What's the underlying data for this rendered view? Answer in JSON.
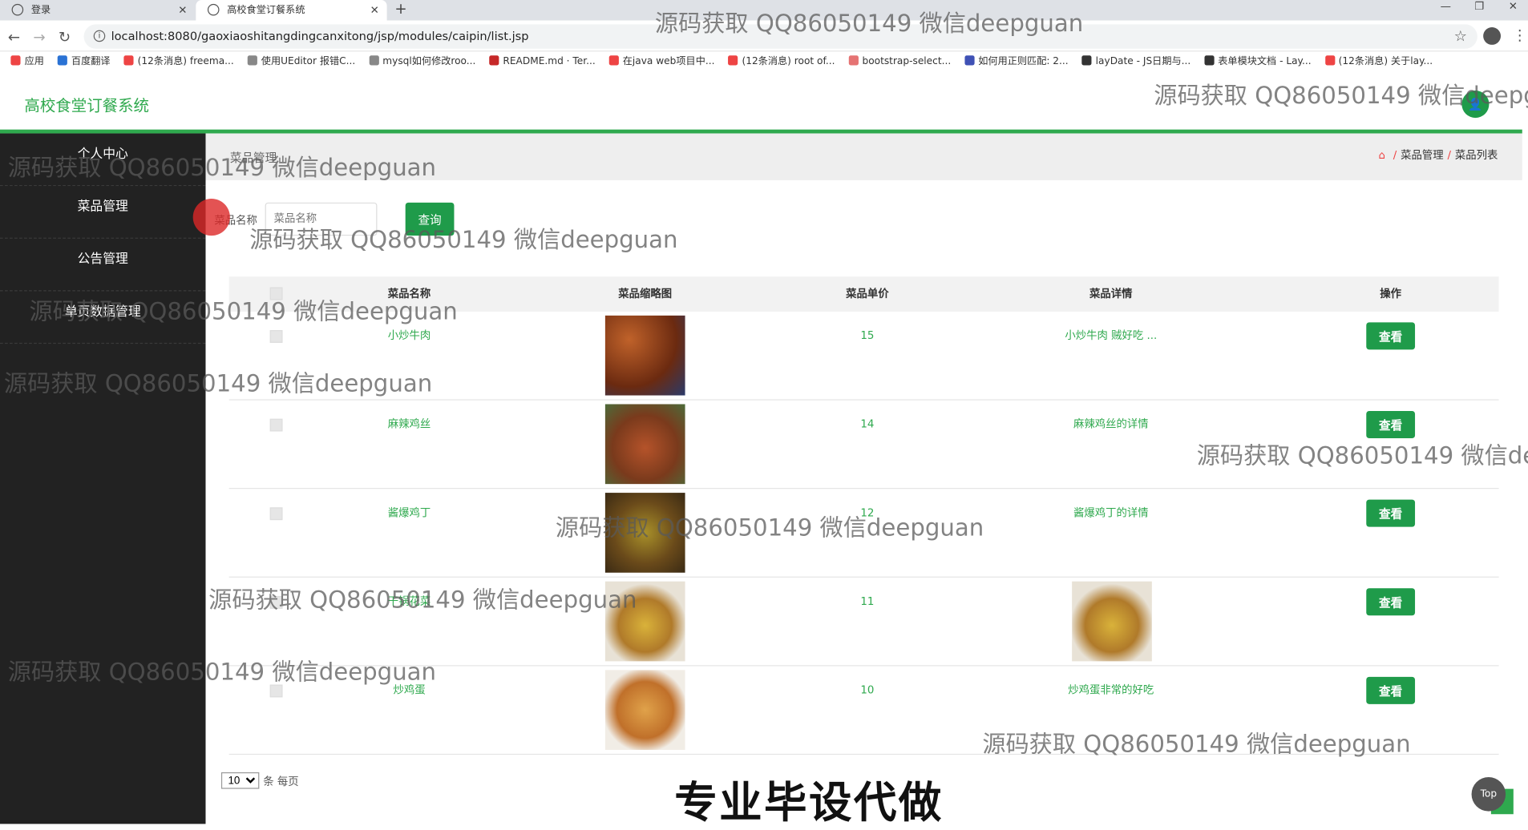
{
  "browser": {
    "tabs": [
      {
        "title": "登录",
        "active": false
      },
      {
        "title": "高校食堂订餐系统",
        "active": true
      }
    ],
    "new_tab": "+",
    "url": "localhost:8080/gaoxiaoshitangdingcanxitong/jsp/modules/caipin/list.jsp",
    "bookmarks": [
      {
        "label": "应用",
        "icon_color": "#e44"
      },
      {
        "label": "百度翻译",
        "icon_color": "#2a72d4"
      },
      {
        "label": "(12条消息) freema...",
        "icon_color": "#e44"
      },
      {
        "label": "使用UEditor 报错C...",
        "icon_color": "#888"
      },
      {
        "label": "mysql如何修改roo...",
        "icon_color": "#888"
      },
      {
        "label": "README.md · Ter...",
        "icon_color": "#c62828"
      },
      {
        "label": "在java web项目中...",
        "icon_color": "#e44"
      },
      {
        "label": "(12条消息) root of...",
        "icon_color": "#e44"
      },
      {
        "label": "bootstrap-select...",
        "icon_color": "#e57373"
      },
      {
        "label": "如何用正则匹配: 2...",
        "icon_color": "#3f51b5"
      },
      {
        "label": "layDate - JS日期与...",
        "icon_color": "#333"
      },
      {
        "label": "表单模块文档 - Lay...",
        "icon_color": "#333"
      },
      {
        "label": "(12条消息) 关于lay...",
        "icon_color": "#e44"
      }
    ]
  },
  "app": {
    "title": "高校食堂订餐系统",
    "avatar_icon": "user-icon"
  },
  "sidebar": {
    "items": [
      {
        "label": "个人中心"
      },
      {
        "label": "菜品管理"
      },
      {
        "label": "公告管理"
      },
      {
        "label": "单页数据管理"
      }
    ]
  },
  "breadcrumb": {
    "section_title": "菜品管理",
    "items": [
      "菜品管理",
      "菜品列表"
    ]
  },
  "search": {
    "label": "菜品名称",
    "placeholder": "菜品名称",
    "button": "查询"
  },
  "table": {
    "headers": [
      "菜品名称",
      "菜品缩略图",
      "菜品单价",
      "菜品详情",
      "操作"
    ],
    "rows": [
      {
        "name": "小炒牛肉",
        "price": "15",
        "detail": "小炒牛肉 贼好吃 ...",
        "action": "查看"
      },
      {
        "name": "麻辣鸡丝",
        "price": "14",
        "detail": "麻辣鸡丝的详情",
        "action": "查看"
      },
      {
        "name": "酱爆鸡丁",
        "price": "12",
        "detail": "酱爆鸡丁的详情",
        "action": "查看"
      },
      {
        "name": "干锅花菜",
        "price": "11",
        "detail": "",
        "action": "查看"
      },
      {
        "name": "炒鸡蛋",
        "price": "10",
        "detail": "炒鸡蛋非常的好吃",
        "action": "查看"
      }
    ]
  },
  "pagination": {
    "page_size": "10",
    "page_size_label": "条 每页"
  },
  "top_button": "Top",
  "watermark": "源码获取 QQ86050149 微信deepguan",
  "banner": "专业毕设代做",
  "colors": {
    "accent": "#2fa94e",
    "sidebar": "#222222"
  }
}
